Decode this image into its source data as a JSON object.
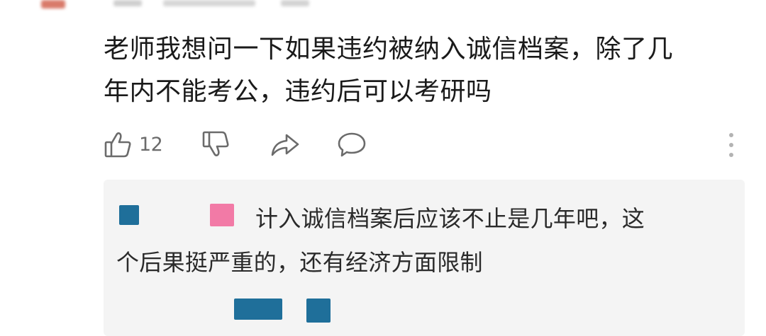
{
  "comment": {
    "line1": "老师我想问一下如果违约被纳入诚信档案，除了几",
    "line2": "年内不能考公，违约后可以考研吗"
  },
  "actions": {
    "like_count": "12",
    "like_icon": "thumbs-up-icon",
    "dislike_icon": "thumbs-down-icon",
    "share_icon": "share-icon",
    "reply_icon": "comment-bubble-icon",
    "more_icon": "more-vertical-icon"
  },
  "reply": {
    "line1": "计入诚信档案后应该不止是几年吧，这",
    "line2": "个后果挺严重的，还有经济方面限制"
  },
  "colors": {
    "avatar_mosaic_blue": "#1f6f9a",
    "avatar_mosaic_pink": "#f27aa6",
    "header_mosaic_red": "#d97a6a",
    "header_mosaic_gray": "#cfcfcf",
    "icon_gray": "#6b6b6b",
    "reply_background": "#f4f4f4"
  }
}
